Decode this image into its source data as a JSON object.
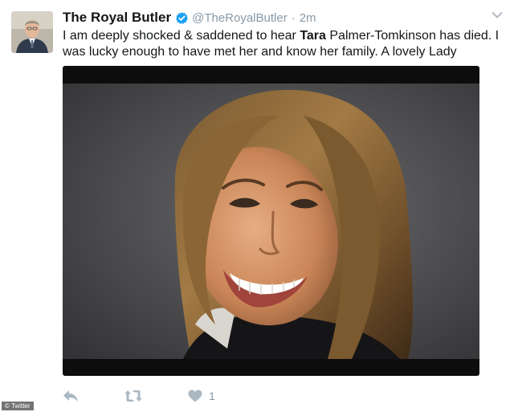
{
  "tweet": {
    "display_name": "The Royal Butler",
    "handle": "@TheRoyalButler",
    "separator": "·",
    "time": "2m",
    "text_before": "I am deeply shocked & saddened to hear ",
    "text_bold": "Tara",
    "text_after": " Palmer-Tomkinson has died. I was lucky enough to have met her and know her family. A lovely Lady",
    "like_count": "1"
  },
  "icons": {
    "verified": "verified-badge-icon",
    "menu": "chevron-down-icon",
    "reply": "reply-icon",
    "retweet": "retweet-icon",
    "like": "heart-icon"
  },
  "colors": {
    "text": "#14171a",
    "muted": "#8899a6",
    "verified_blue": "#1da1f2",
    "action_gray": "#aab8c2"
  },
  "credit": "© Twitter"
}
